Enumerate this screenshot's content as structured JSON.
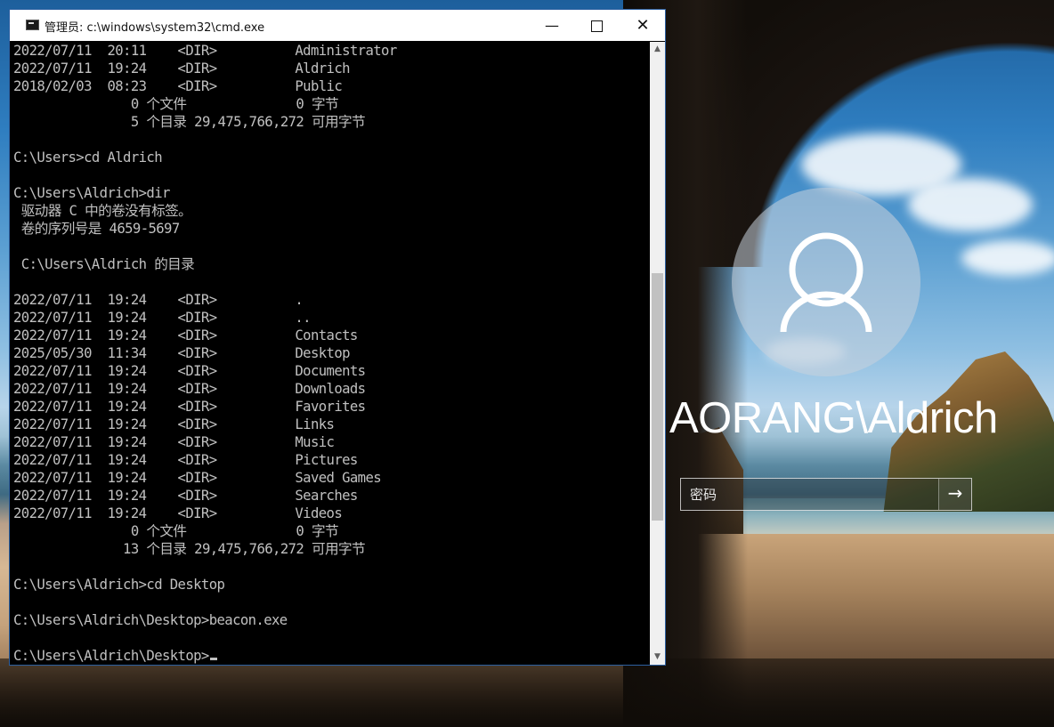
{
  "cmd_window": {
    "title": "管理员: c:\\windows\\system32\\cmd.exe",
    "minimize_label": "—",
    "close_label": "✕",
    "lines": [
      "2022/07/11  20:11    <DIR>          Administrator",
      "2022/07/11  19:24    <DIR>          Aldrich",
      "2018/02/03  08:23    <DIR>          Public",
      "               0 个文件              0 字节",
      "               5 个目录 29,475,766,272 可用字节",
      "",
      "C:\\Users>cd Aldrich",
      "",
      "C:\\Users\\Aldrich>dir",
      " 驱动器 C 中的卷没有标签。",
      " 卷的序列号是 4659-5697",
      "",
      " C:\\Users\\Aldrich 的目录",
      "",
      "2022/07/11  19:24    <DIR>          .",
      "2022/07/11  19:24    <DIR>          ..",
      "2022/07/11  19:24    <DIR>          Contacts",
      "2025/05/30  11:34    <DIR>          Desktop",
      "2022/07/11  19:24    <DIR>          Documents",
      "2022/07/11  19:24    <DIR>          Downloads",
      "2022/07/11  19:24    <DIR>          Favorites",
      "2022/07/11  19:24    <DIR>          Links",
      "2022/07/11  19:24    <DIR>          Music",
      "2022/07/11  19:24    <DIR>          Pictures",
      "2022/07/11  19:24    <DIR>          Saved Games",
      "2022/07/11  19:24    <DIR>          Searches",
      "2022/07/11  19:24    <DIR>          Videos",
      "               0 个文件              0 字节",
      "              13 个目录 29,475,766,272 可用字节",
      "",
      "C:\\Users\\Aldrich>cd Desktop",
      "",
      "C:\\Users\\Aldrich\\Desktop>beacon.exe",
      ""
    ],
    "prompt": "C:\\Users\\Aldrich\\Desktop>",
    "scroll_up_icon": "▲",
    "scroll_down_icon": "▼"
  },
  "lock_screen": {
    "username": "AORANG\\Aldrich",
    "password_placeholder": "密码",
    "submit_icon": "→"
  }
}
